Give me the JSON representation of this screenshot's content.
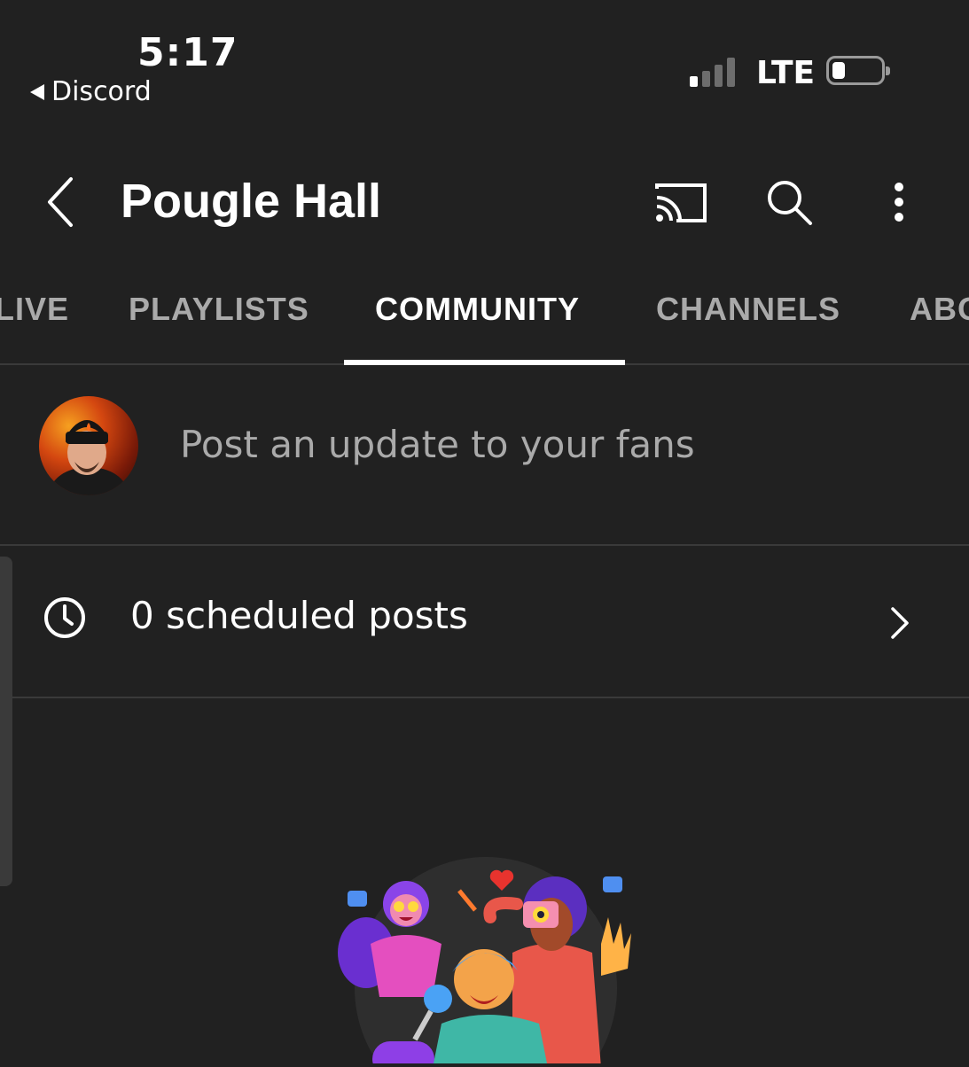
{
  "status_bar": {
    "time": "5:17",
    "back_app": "Discord",
    "network": "LTE"
  },
  "header": {
    "title": "Pougle Hall",
    "icons": [
      "back-arrow-icon",
      "cast-icon",
      "search-icon",
      "more-vert-icon"
    ]
  },
  "tabs": [
    {
      "label": "LIVE"
    },
    {
      "label": "PLAYLISTS"
    },
    {
      "label": "COMMUNITY",
      "active": true
    },
    {
      "label": "CHANNELS"
    },
    {
      "label": "ABO"
    }
  ],
  "post_box": {
    "placeholder": "Post an update to your fans"
  },
  "scheduled": {
    "label": "0 scheduled posts"
  },
  "colors": {
    "background": "#212121",
    "text": "#ffffff",
    "muted": "#aaaaaa",
    "divider": "#3a3a3a"
  }
}
